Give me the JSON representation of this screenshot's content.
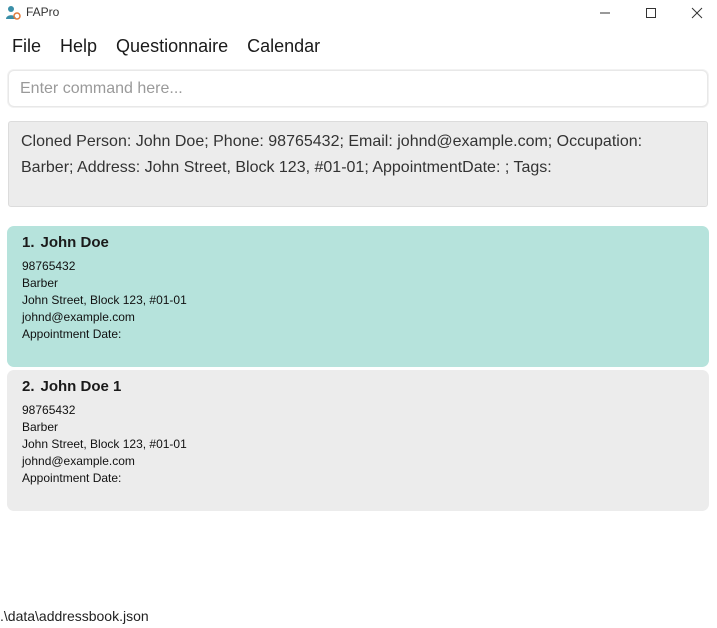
{
  "window": {
    "title": "FAPro",
    "icon": "app-person-icon"
  },
  "menu": {
    "items": [
      "File",
      "Help",
      "Questionnaire",
      "Calendar"
    ]
  },
  "command": {
    "placeholder": "Enter command here...",
    "value": ""
  },
  "result": {
    "text": "Cloned Person: John Doe; Phone: 98765432; Email: johnd@example.com; Occupation: Barber; Address: John Street, Block 123, #01-01; AppointmentDate: ; Tags:"
  },
  "persons": [
    {
      "index": "1.",
      "name": "John Doe",
      "phone": "98765432",
      "occupation": "Barber",
      "address": "John Street, Block 123, #01-01",
      "email": "johnd@example.com",
      "appointment": "Appointment Date:"
    },
    {
      "index": "2.",
      "name": "John Doe 1",
      "phone": "98765432",
      "occupation": "Barber",
      "address": "John Street, Block 123, #01-01",
      "email": "johnd@example.com",
      "appointment": "Appointment Date:"
    }
  ],
  "status": {
    "path": ".\\data\\addressbook.json"
  },
  "colors": {
    "selected_card": "#b6e3dc",
    "card": "#ececec",
    "result_bg": "#ececec"
  }
}
